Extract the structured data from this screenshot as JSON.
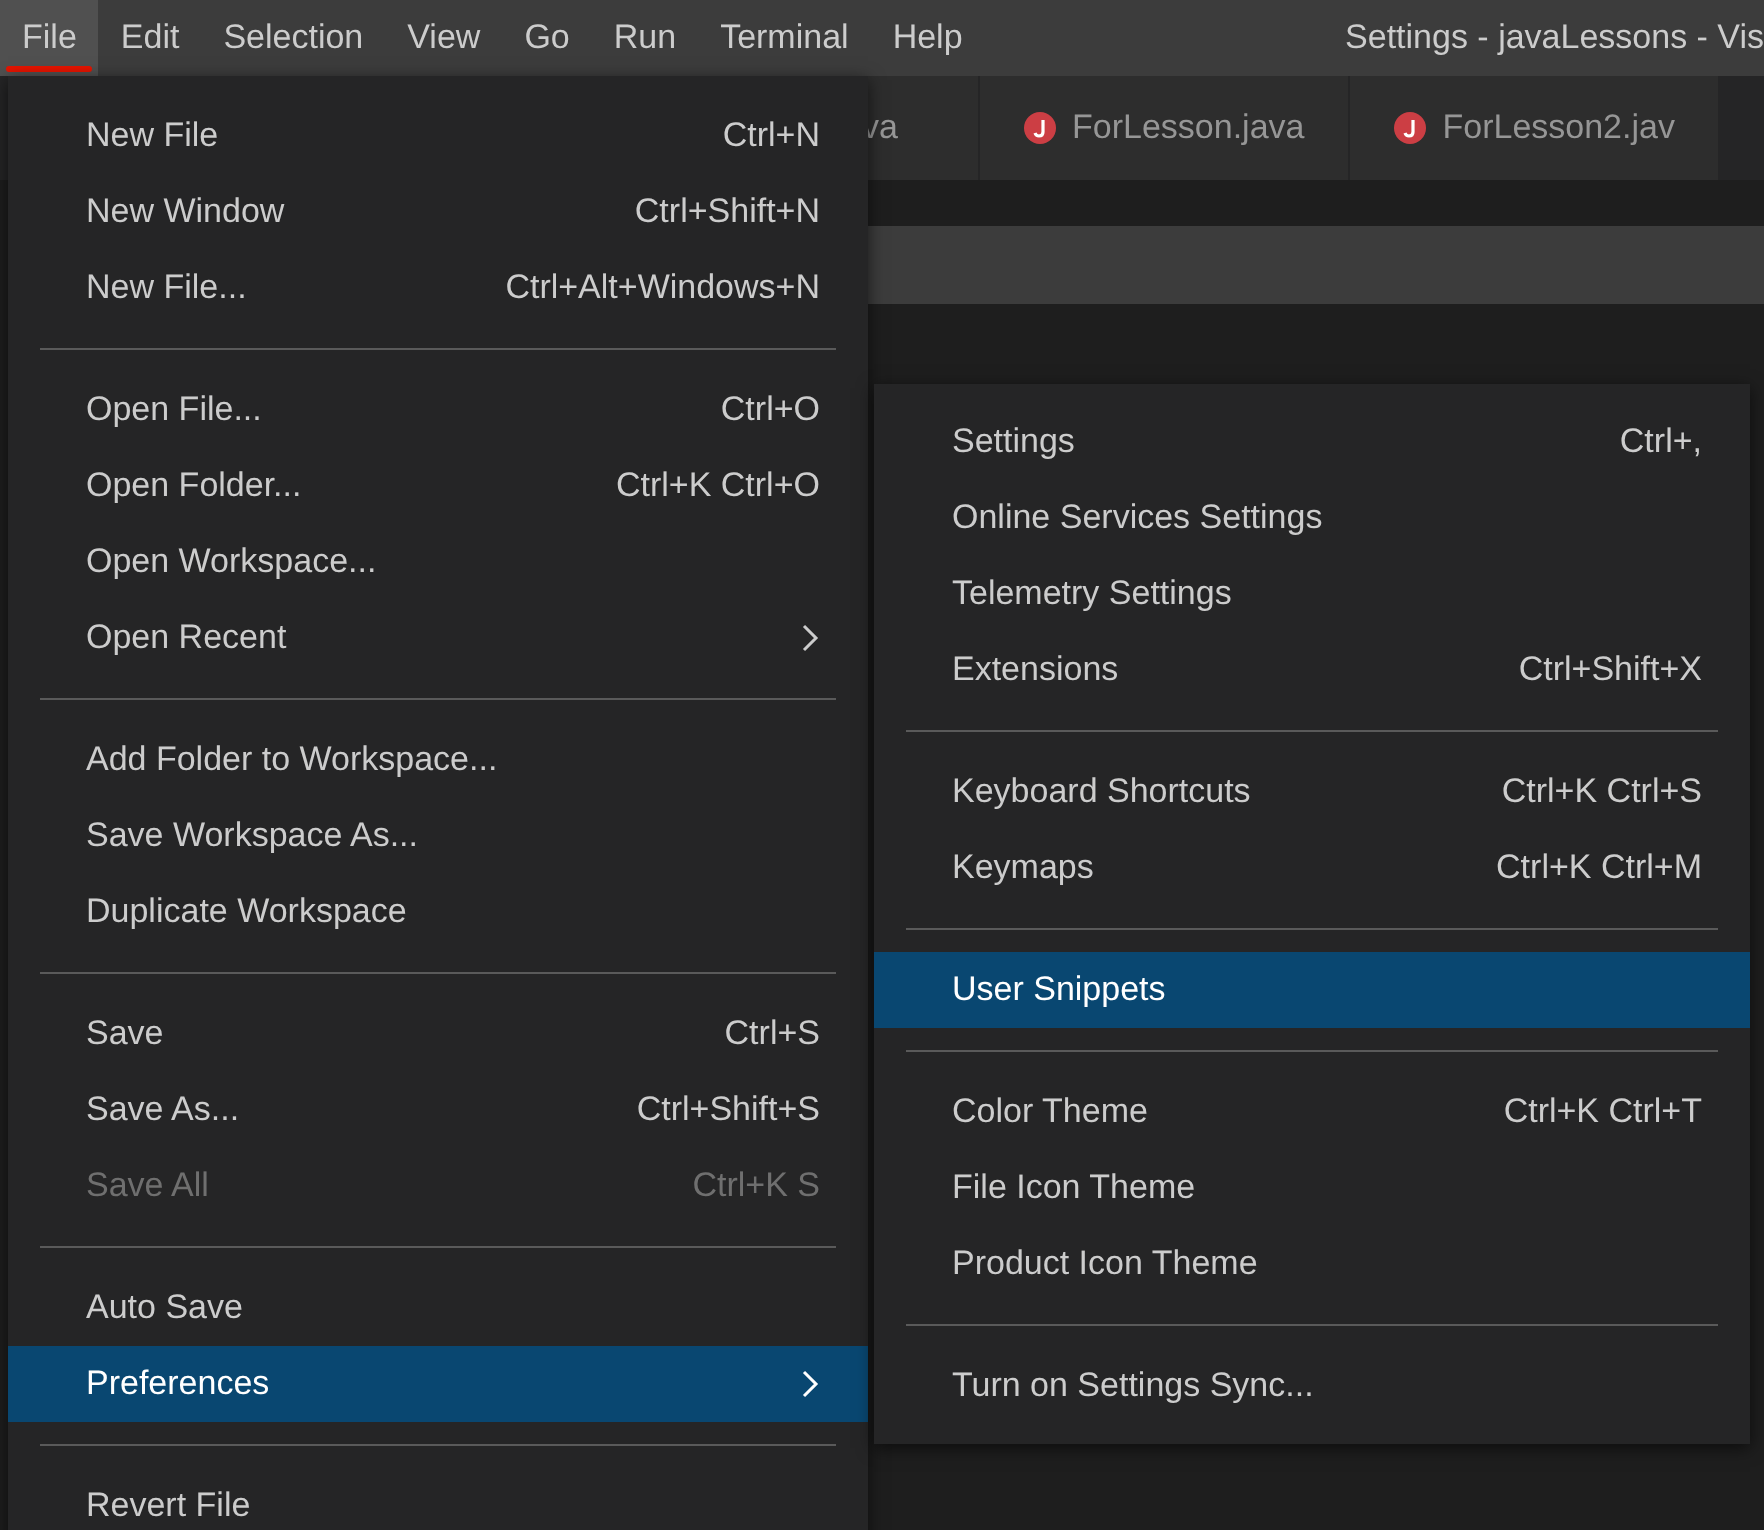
{
  "menubar": [
    {
      "label": "File",
      "selected": true
    },
    {
      "label": "Edit",
      "selected": false
    },
    {
      "label": "Selection",
      "selected": false
    },
    {
      "label": "View",
      "selected": false
    },
    {
      "label": "Go",
      "selected": false
    },
    {
      "label": "Run",
      "selected": false
    },
    {
      "label": "Terminal",
      "selected": false
    },
    {
      "label": "Help",
      "selected": false
    }
  ],
  "window": {
    "title": "Settings - javaLessons - Vis"
  },
  "tabs": [
    {
      "label": "va",
      "icon": false
    },
    {
      "label": "ForLesson.java",
      "icon": true
    },
    {
      "label": "ForLesson2.jav",
      "icon": true
    }
  ],
  "file_menu": [
    {
      "kind": "item",
      "label": "New File",
      "shortcut": "Ctrl+N",
      "disabled": false,
      "selected": false,
      "submenu": false
    },
    {
      "kind": "item",
      "label": "New Window",
      "shortcut": "Ctrl+Shift+N",
      "disabled": false,
      "selected": false,
      "submenu": false
    },
    {
      "kind": "item",
      "label": "New File...",
      "shortcut": "Ctrl+Alt+Windows+N",
      "disabled": false,
      "selected": false,
      "submenu": false
    },
    {
      "kind": "separator"
    },
    {
      "kind": "item",
      "label": "Open File...",
      "shortcut": "Ctrl+O",
      "disabled": false,
      "selected": false,
      "submenu": false
    },
    {
      "kind": "item",
      "label": "Open Folder...",
      "shortcut": "Ctrl+K Ctrl+O",
      "disabled": false,
      "selected": false,
      "submenu": false
    },
    {
      "kind": "item",
      "label": "Open Workspace...",
      "disabled": false,
      "selected": false,
      "submenu": false
    },
    {
      "kind": "item",
      "label": "Open Recent",
      "disabled": false,
      "selected": false,
      "submenu": true
    },
    {
      "kind": "separator"
    },
    {
      "kind": "item",
      "label": "Add Folder to Workspace...",
      "disabled": false,
      "selected": false,
      "submenu": false
    },
    {
      "kind": "item",
      "label": "Save Workspace As...",
      "disabled": false,
      "selected": false,
      "submenu": false
    },
    {
      "kind": "item",
      "label": "Duplicate Workspace",
      "disabled": false,
      "selected": false,
      "submenu": false
    },
    {
      "kind": "separator"
    },
    {
      "kind": "item",
      "label": "Save",
      "shortcut": "Ctrl+S",
      "disabled": false,
      "selected": false,
      "submenu": false
    },
    {
      "kind": "item",
      "label": "Save As...",
      "shortcut": "Ctrl+Shift+S",
      "disabled": false,
      "selected": false,
      "submenu": false
    },
    {
      "kind": "item",
      "label": "Save All",
      "shortcut": "Ctrl+K S",
      "disabled": true,
      "selected": false,
      "submenu": false
    },
    {
      "kind": "separator"
    },
    {
      "kind": "item",
      "label": "Auto Save",
      "disabled": false,
      "selected": false,
      "submenu": false
    },
    {
      "kind": "item",
      "label": "Preferences",
      "disabled": false,
      "selected": true,
      "submenu": true
    },
    {
      "kind": "separator"
    },
    {
      "kind": "item",
      "label": "Revert File",
      "disabled": false,
      "selected": false,
      "submenu": false
    }
  ],
  "preferences_menu": [
    {
      "kind": "item",
      "label": "Settings",
      "shortcut": "Ctrl+,",
      "disabled": false,
      "selected": false,
      "submenu": false
    },
    {
      "kind": "item",
      "label": "Online Services Settings",
      "disabled": false,
      "selected": false,
      "submenu": false
    },
    {
      "kind": "item",
      "label": "Telemetry Settings",
      "disabled": false,
      "selected": false,
      "submenu": false
    },
    {
      "kind": "item",
      "label": "Extensions",
      "shortcut": "Ctrl+Shift+X",
      "disabled": false,
      "selected": false,
      "submenu": false
    },
    {
      "kind": "separator"
    },
    {
      "kind": "item",
      "label": "Keyboard Shortcuts",
      "shortcut": "Ctrl+K Ctrl+S",
      "disabled": false,
      "selected": false,
      "submenu": false
    },
    {
      "kind": "item",
      "label": "Keymaps",
      "shortcut": "Ctrl+K Ctrl+M",
      "disabled": false,
      "selected": false,
      "submenu": false
    },
    {
      "kind": "separator"
    },
    {
      "kind": "item",
      "label": "User Snippets",
      "disabled": false,
      "selected": true,
      "submenu": false
    },
    {
      "kind": "separator"
    },
    {
      "kind": "item",
      "label": "Color Theme",
      "shortcut": "Ctrl+K Ctrl+T",
      "disabled": false,
      "selected": false,
      "submenu": false
    },
    {
      "kind": "item",
      "label": "File Icon Theme",
      "disabled": false,
      "selected": false,
      "submenu": false
    },
    {
      "kind": "item",
      "label": "Product Icon Theme",
      "disabled": false,
      "selected": false,
      "submenu": false
    },
    {
      "kind": "separator"
    },
    {
      "kind": "item",
      "label": "Turn on Settings Sync...",
      "disabled": false,
      "selected": false,
      "submenu": false
    }
  ]
}
